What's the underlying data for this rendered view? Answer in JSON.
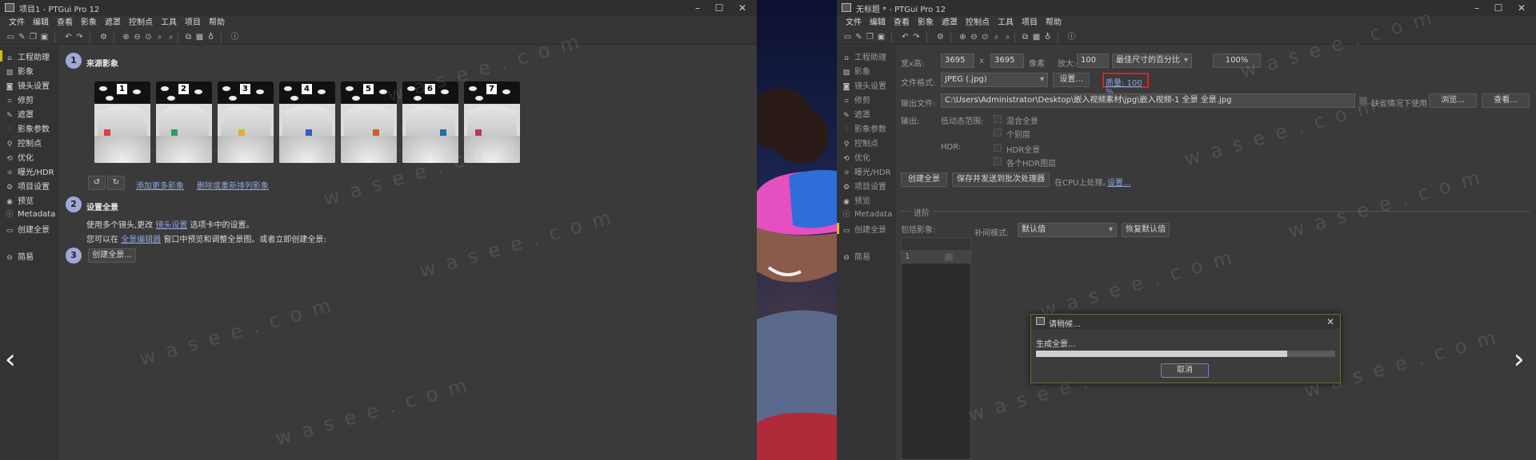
{
  "left_window": {
    "title": "项目1 - PTGui Pro 12",
    "menu": [
      "文件",
      "编辑",
      "查看",
      "影象",
      "遮罩",
      "控制点",
      "工具",
      "项目",
      "帮助"
    ],
    "sidebar": [
      {
        "label": "工程助理",
        "icon": "home-icon"
      },
      {
        "label": "影象",
        "icon": "image-icon"
      },
      {
        "label": "镜头设置",
        "icon": "camera-icon"
      },
      {
        "label": "修剪",
        "icon": "crop-icon"
      },
      {
        "label": "遮罩",
        "icon": "mask-icon"
      },
      {
        "label": "影象参数",
        "icon": "sliders-icon"
      },
      {
        "label": "控制点",
        "icon": "control-points-icon"
      },
      {
        "label": "优化",
        "icon": "optimize-icon"
      },
      {
        "label": "曝光/HDR",
        "icon": "exposure-icon"
      },
      {
        "label": "项目设置",
        "icon": "gear-icon"
      },
      {
        "label": "预览",
        "icon": "eye-icon"
      },
      {
        "label": "Metadata",
        "icon": "info-icon"
      },
      {
        "label": "创建全景",
        "icon": "panorama-icon"
      },
      {
        "label": "简易",
        "icon": "simple-icon"
      }
    ],
    "step1": {
      "num": "1",
      "title": "来源影象"
    },
    "thumbnails": [
      "1",
      "2",
      "3",
      "4",
      "5",
      "6",
      "7"
    ],
    "add_images_link": "添加更多影象",
    "remove_images_link": "删除或重新排列影象",
    "step2": {
      "num": "2",
      "title": "设置全景"
    },
    "step2_line1_pre": "使用多个镜头,更改",
    "step2_line1_link": "镜头设置",
    "step2_line1_post": "选项卡中的设置。",
    "step2_line2_pre": "您可以在",
    "step2_line2_link": "全景编辑器",
    "step2_line2_post": "窗口中预览和调整全景图。或者立即创建全景:",
    "step3": {
      "num": "3"
    },
    "create_button": "创建全景..."
  },
  "right_window": {
    "title": "无标题 * - PTGui Pro 12",
    "menu": [
      "文件",
      "编辑",
      "查看",
      "影象",
      "遮罩",
      "控制点",
      "工具",
      "项目",
      "帮助"
    ],
    "sidebar": [
      {
        "label": "工程助理",
        "icon": "home-icon"
      },
      {
        "label": "影象",
        "icon": "image-icon"
      },
      {
        "label": "镜头设置",
        "icon": "camera-icon"
      },
      {
        "label": "修剪",
        "icon": "crop-icon"
      },
      {
        "label": "遮罩",
        "icon": "mask-icon"
      },
      {
        "label": "影象参数",
        "icon": "sliders-icon"
      },
      {
        "label": "控制点",
        "icon": "control-points-icon"
      },
      {
        "label": "优化",
        "icon": "optimize-icon"
      },
      {
        "label": "曝光/HDR",
        "icon": "exposure-icon"
      },
      {
        "label": "项目设置",
        "icon": "gear-icon"
      },
      {
        "label": "预览",
        "icon": "eye-icon"
      },
      {
        "label": "Metadata",
        "icon": "info-icon"
      },
      {
        "label": "创建全景",
        "icon": "panorama-icon"
      },
      {
        "label": "简易",
        "icon": "simple-icon"
      }
    ],
    "width_height_label": "宽x高:",
    "width_value": "3695",
    "x_label": "x",
    "height_value": "3695",
    "pixels_label": "像素",
    "zoom_label": "放大:",
    "zoom_value": "100",
    "size_mode": "最佳尺寸的百分比",
    "size_percent_button": "100%",
    "format_label": "文件格式:",
    "format_value": "JPEG (.jpg)",
    "settings_button": "设置...",
    "quality_text": "质量: 100 %",
    "output_file_label": "输出文件:",
    "output_file_value": "C:\\Users\\Administrator\\Desktop\\嵌入视频素材\\jpg\\嵌入视频-1 全景 全景.jpg",
    "use_default_label": "缺省情况下使用",
    "browse_button": "浏览...",
    "view_button": "查看...",
    "output_label": "输出:",
    "ldr_label": "低动态范围:",
    "blend_label": "混合全景",
    "layers_label": "个别层",
    "hdr_label": "HDR:",
    "hdr_pano_label": "HDR全景",
    "hdr_layers_label": "各个HDR图层",
    "create_button": "创建全景",
    "save_batch_button": "保存并发送到批次处理器",
    "cpu_text": "在CPU上处理。",
    "cpu_settings_link": "设置...",
    "advanced_label": "进阶",
    "include_images_label": "包括影象:",
    "interp_label": "补间模式:",
    "interp_value": "默认值",
    "restore_default_button": "恢复默认值",
    "list_row": "1"
  },
  "dialog": {
    "title": "请稍候...",
    "message": "生成全景...",
    "progress": 0.84,
    "cancel_button": "取消"
  },
  "watermark_text": "wasee.com",
  "nav_prev": "‹",
  "nav_next": "›"
}
